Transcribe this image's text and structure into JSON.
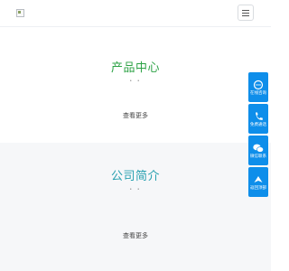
{
  "header": {
    "logo_alt": "logo",
    "menu_icon": "hamburger-icon"
  },
  "sections": [
    {
      "title": "产品中心",
      "dots": "• •",
      "more": "查看更多"
    },
    {
      "title": "公司简介",
      "dots": "• •",
      "more": "查看更多"
    }
  ],
  "float_bar": {
    "color": "#0e8eea",
    "items": [
      {
        "icon": "chat-icon",
        "label": "在线咨询"
      },
      {
        "icon": "phone-icon",
        "label": "免费通话"
      },
      {
        "icon": "wechat-icon",
        "label": "微信联系"
      },
      {
        "icon": "arrow-up-icon",
        "label": "返回顶部"
      }
    ]
  }
}
